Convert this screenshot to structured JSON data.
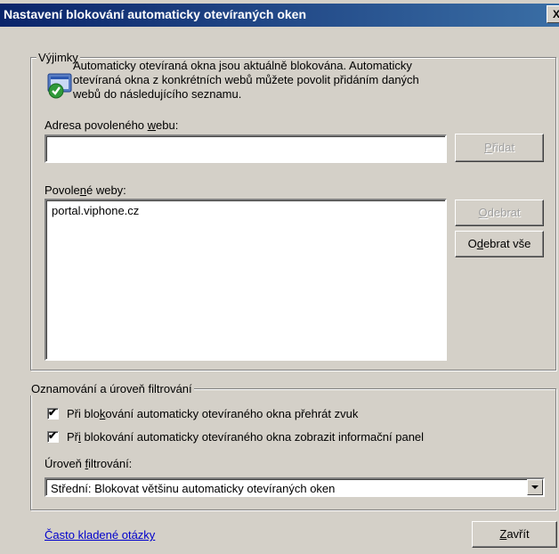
{
  "window": {
    "title": "Nastavení blokování automaticky otevíraných oken",
    "close_glyph": "X"
  },
  "exceptions": {
    "legend": "Výjimky",
    "info_line1": "Automaticky otevíraná okna jsou aktuálně blokována. Automaticky",
    "info_line2": "otevíraná okna z konkrétních webů můžete povolit přidáním daných",
    "info_line3": "webů do následujícího seznamu.",
    "address_label_pre": "Adresa povoleného ",
    "address_label_u": "w",
    "address_label_post": "ebu:",
    "address_value": "",
    "add_button_u": "P",
    "add_button_post": "řidat",
    "allowed_label_pre": "Povole",
    "allowed_label_u": "n",
    "allowed_label_post": "é weby:",
    "allowed_sites": [
      "portal.viphone.cz"
    ],
    "remove_button_u": "O",
    "remove_button_post": "debrat",
    "remove_all_pre": "O",
    "remove_all_u": "d",
    "remove_all_post": "ebrat vše"
  },
  "notifications": {
    "legend": "Oznamování a úroveň filtrování",
    "sound_pre": "Při blo",
    "sound_u": "k",
    "sound_post": "ování automaticky otevíraného okna přehrát zvuk",
    "sound_checked": true,
    "infobar_pre": "Př",
    "infobar_u": "i",
    "infobar_post": " blokování automaticky otevíraného okna zobrazit informační panel",
    "infobar_checked": true,
    "level_label_pre": "Úroveň ",
    "level_label_u": "f",
    "level_label_post": "iltrování:",
    "level_selected": "Střední: Blokovat většinu automaticky otevíraných oken"
  },
  "footer": {
    "faq_link": "Často kladené otázky",
    "close_u": "Z",
    "close_post": "avřít"
  },
  "icons": {
    "info": "shield-check-icon",
    "checkmark": "✔"
  }
}
